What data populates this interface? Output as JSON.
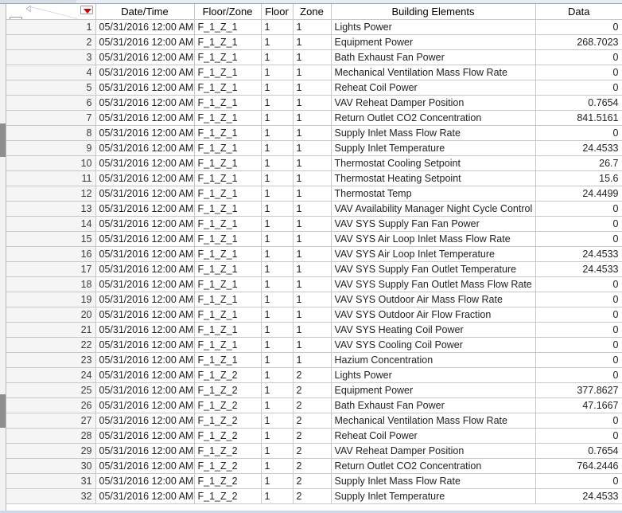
{
  "window": {
    "corner": {
      "collapse_icon": "triangle-left-icon",
      "top_dropdown_icon": "red-triangle-dropdown-icon",
      "bottom_dropdown_icon": "red-triangle-dropdown-icon"
    }
  },
  "table": {
    "columns": [
      {
        "key": "rownum",
        "label": ""
      },
      {
        "key": "datetime",
        "label": "Date/Time"
      },
      {
        "key": "fz",
        "label": "Floor/Zone"
      },
      {
        "key": "floor",
        "label": "Floor"
      },
      {
        "key": "zone",
        "label": "Zone"
      },
      {
        "key": "elem",
        "label": "Building Elements"
      },
      {
        "key": "data",
        "label": "Data"
      }
    ],
    "rows": [
      {
        "rownum": "1",
        "datetime": "05/31/2016 12:00 AM",
        "fz": "F_1_Z_1",
        "floor": "1",
        "zone": "1",
        "elem": "Lights Power",
        "data": "0"
      },
      {
        "rownum": "2",
        "datetime": "05/31/2016 12:00 AM",
        "fz": "F_1_Z_1",
        "floor": "1",
        "zone": "1",
        "elem": "Equipment Power",
        "data": "268.7023"
      },
      {
        "rownum": "3",
        "datetime": "05/31/2016 12:00 AM",
        "fz": "F_1_Z_1",
        "floor": "1",
        "zone": "1",
        "elem": "Bath Exhaust Fan Power",
        "data": "0"
      },
      {
        "rownum": "4",
        "datetime": "05/31/2016 12:00 AM",
        "fz": "F_1_Z_1",
        "floor": "1",
        "zone": "1",
        "elem": "Mechanical Ventilation Mass Flow Rate",
        "data": "0"
      },
      {
        "rownum": "5",
        "datetime": "05/31/2016 12:00 AM",
        "fz": "F_1_Z_1",
        "floor": "1",
        "zone": "1",
        "elem": "Reheat Coil Power",
        "data": "0"
      },
      {
        "rownum": "6",
        "datetime": "05/31/2016 12:00 AM",
        "fz": "F_1_Z_1",
        "floor": "1",
        "zone": "1",
        "elem": "VAV Reheat Damper Position",
        "data": "0.7654"
      },
      {
        "rownum": "7",
        "datetime": "05/31/2016 12:00 AM",
        "fz": "F_1_Z_1",
        "floor": "1",
        "zone": "1",
        "elem": "Return Outlet CO2 Concentration",
        "data": "841.5161"
      },
      {
        "rownum": "8",
        "datetime": "05/31/2016 12:00 AM",
        "fz": "F_1_Z_1",
        "floor": "1",
        "zone": "1",
        "elem": "Supply Inlet Mass Flow Rate",
        "data": "0"
      },
      {
        "rownum": "9",
        "datetime": "05/31/2016 12:00 AM",
        "fz": "F_1_Z_1",
        "floor": "1",
        "zone": "1",
        "elem": "Supply Inlet Temperature",
        "data": "24.4533"
      },
      {
        "rownum": "10",
        "datetime": "05/31/2016 12:00 AM",
        "fz": "F_1_Z_1",
        "floor": "1",
        "zone": "1",
        "elem": "Thermostat Cooling Setpoint",
        "data": "26.7"
      },
      {
        "rownum": "11",
        "datetime": "05/31/2016 12:00 AM",
        "fz": "F_1_Z_1",
        "floor": "1",
        "zone": "1",
        "elem": "Thermostat Heating Setpoint",
        "data": "15.6"
      },
      {
        "rownum": "12",
        "datetime": "05/31/2016 12:00 AM",
        "fz": "F_1_Z_1",
        "floor": "1",
        "zone": "1",
        "elem": "Thermostat Temp",
        "data": "24.4499"
      },
      {
        "rownum": "13",
        "datetime": "05/31/2016 12:00 AM",
        "fz": "F_1_Z_1",
        "floor": "1",
        "zone": "1",
        "elem": "VAV Availability Manager Night Cycle Control Status",
        "data": "0"
      },
      {
        "rownum": "14",
        "datetime": "05/31/2016 12:00 AM",
        "fz": "F_1_Z_1",
        "floor": "1",
        "zone": "1",
        "elem": "VAV SYS Supply Fan Fan Power",
        "data": "0"
      },
      {
        "rownum": "15",
        "datetime": "05/31/2016 12:00 AM",
        "fz": "F_1_Z_1",
        "floor": "1",
        "zone": "1",
        "elem": "VAV SYS Air Loop Inlet Mass Flow Rate",
        "data": "0"
      },
      {
        "rownum": "16",
        "datetime": "05/31/2016 12:00 AM",
        "fz": "F_1_Z_1",
        "floor": "1",
        "zone": "1",
        "elem": "VAV SYS Air Loop Inlet Temperature",
        "data": "24.4533"
      },
      {
        "rownum": "17",
        "datetime": "05/31/2016 12:00 AM",
        "fz": "F_1_Z_1",
        "floor": "1",
        "zone": "1",
        "elem": "VAV SYS Supply Fan Outlet Temperature",
        "data": "24.4533"
      },
      {
        "rownum": "18",
        "datetime": "05/31/2016 12:00 AM",
        "fz": "F_1_Z_1",
        "floor": "1",
        "zone": "1",
        "elem": "VAV SYS Supply Fan Outlet Mass Flow Rate",
        "data": "0"
      },
      {
        "rownum": "19",
        "datetime": "05/31/2016 12:00 AM",
        "fz": "F_1_Z_1",
        "floor": "1",
        "zone": "1",
        "elem": "VAV SYS Outdoor Air Mass Flow Rate",
        "data": "0"
      },
      {
        "rownum": "20",
        "datetime": "05/31/2016 12:00 AM",
        "fz": "F_1_Z_1",
        "floor": "1",
        "zone": "1",
        "elem": "VAV SYS Outdoor Air Flow Fraction",
        "data": "0"
      },
      {
        "rownum": "21",
        "datetime": "05/31/2016 12:00 AM",
        "fz": "F_1_Z_1",
        "floor": "1",
        "zone": "1",
        "elem": "VAV SYS Heating Coil Power",
        "data": "0"
      },
      {
        "rownum": "22",
        "datetime": "05/31/2016 12:00 AM",
        "fz": "F_1_Z_1",
        "floor": "1",
        "zone": "1",
        "elem": "VAV SYS Cooling Coil Power",
        "data": "0"
      },
      {
        "rownum": "23",
        "datetime": "05/31/2016 12:00 AM",
        "fz": "F_1_Z_1",
        "floor": "1",
        "zone": "1",
        "elem": "Hazium Concentration",
        "data": "0"
      },
      {
        "rownum": "24",
        "datetime": "05/31/2016 12:00 AM",
        "fz": "F_1_Z_2",
        "floor": "1",
        "zone": "2",
        "elem": "Lights Power",
        "data": "0"
      },
      {
        "rownum": "25",
        "datetime": "05/31/2016 12:00 AM",
        "fz": "F_1_Z_2",
        "floor": "1",
        "zone": "2",
        "elem": "Equipment Power",
        "data": "377.8627"
      },
      {
        "rownum": "26",
        "datetime": "05/31/2016 12:00 AM",
        "fz": "F_1_Z_2",
        "floor": "1",
        "zone": "2",
        "elem": "Bath Exhaust Fan Power",
        "data": "47.1667"
      },
      {
        "rownum": "27",
        "datetime": "05/31/2016 12:00 AM",
        "fz": "F_1_Z_2",
        "floor": "1",
        "zone": "2",
        "elem": "Mechanical Ventilation Mass Flow Rate",
        "data": "0"
      },
      {
        "rownum": "28",
        "datetime": "05/31/2016 12:00 AM",
        "fz": "F_1_Z_2",
        "floor": "1",
        "zone": "2",
        "elem": "Reheat Coil Power",
        "data": "0"
      },
      {
        "rownum": "29",
        "datetime": "05/31/2016 12:00 AM",
        "fz": "F_1_Z_2",
        "floor": "1",
        "zone": "2",
        "elem": "VAV Reheat Damper Position",
        "data": "0.7654"
      },
      {
        "rownum": "30",
        "datetime": "05/31/2016 12:00 AM",
        "fz": "F_1_Z_2",
        "floor": "1",
        "zone": "2",
        "elem": "Return Outlet CO2 Concentration",
        "data": "764.2446"
      },
      {
        "rownum": "31",
        "datetime": "05/31/2016 12:00 AM",
        "fz": "F_1_Z_2",
        "floor": "1",
        "zone": "2",
        "elem": "Supply Inlet Mass Flow Rate",
        "data": "0"
      },
      {
        "rownum": "32",
        "datetime": "05/31/2016 12:00 AM",
        "fz": "F_1_Z_2",
        "floor": "1",
        "zone": "2",
        "elem": "Supply Inlet Temperature",
        "data": "24.4533"
      }
    ]
  },
  "colors": {
    "dropdown_red": "#cc0000",
    "header_text": "#000000",
    "cell_text": "#222222",
    "rownum_bg": "#f5f5f5",
    "grid_line": "#c8c8c8",
    "chrome": "#d6dde7"
  }
}
